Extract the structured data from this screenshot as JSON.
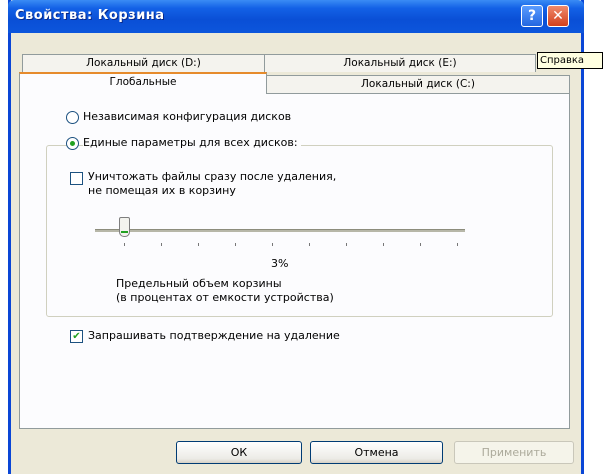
{
  "window": {
    "title": "Свойства: Корзина"
  },
  "titlebar": {
    "help_glyph": "?",
    "close_glyph": "✕"
  },
  "tooltip": {
    "text": "Справка"
  },
  "tabs": {
    "drive_d": "Локальный диск (D:)",
    "drive_e": "Локальный диск (E:)",
    "global": "Глобальные",
    "drive_c": "Локальный диск (C:)"
  },
  "options": {
    "independent": "Независимая конфигурация дисков",
    "uniform": "Единые параметры для всех дисков:",
    "selected": "uniform"
  },
  "delete_immediately": {
    "line1": "Уничтожать файлы сразу после удаления,",
    "line2": "не помещая их в корзину",
    "checked": false
  },
  "slider": {
    "value_percent": 3,
    "value_text": "3%",
    "caption1": "Предельный объем корзины",
    "caption2": "(в процентах от емкости устройства)"
  },
  "confirm": {
    "label": "Запрашивать подтверждение на удаление",
    "checked": true,
    "check_glyph": "✔"
  },
  "buttons": {
    "ok": "ОК",
    "cancel": "Отмена",
    "apply": "Применить"
  }
}
